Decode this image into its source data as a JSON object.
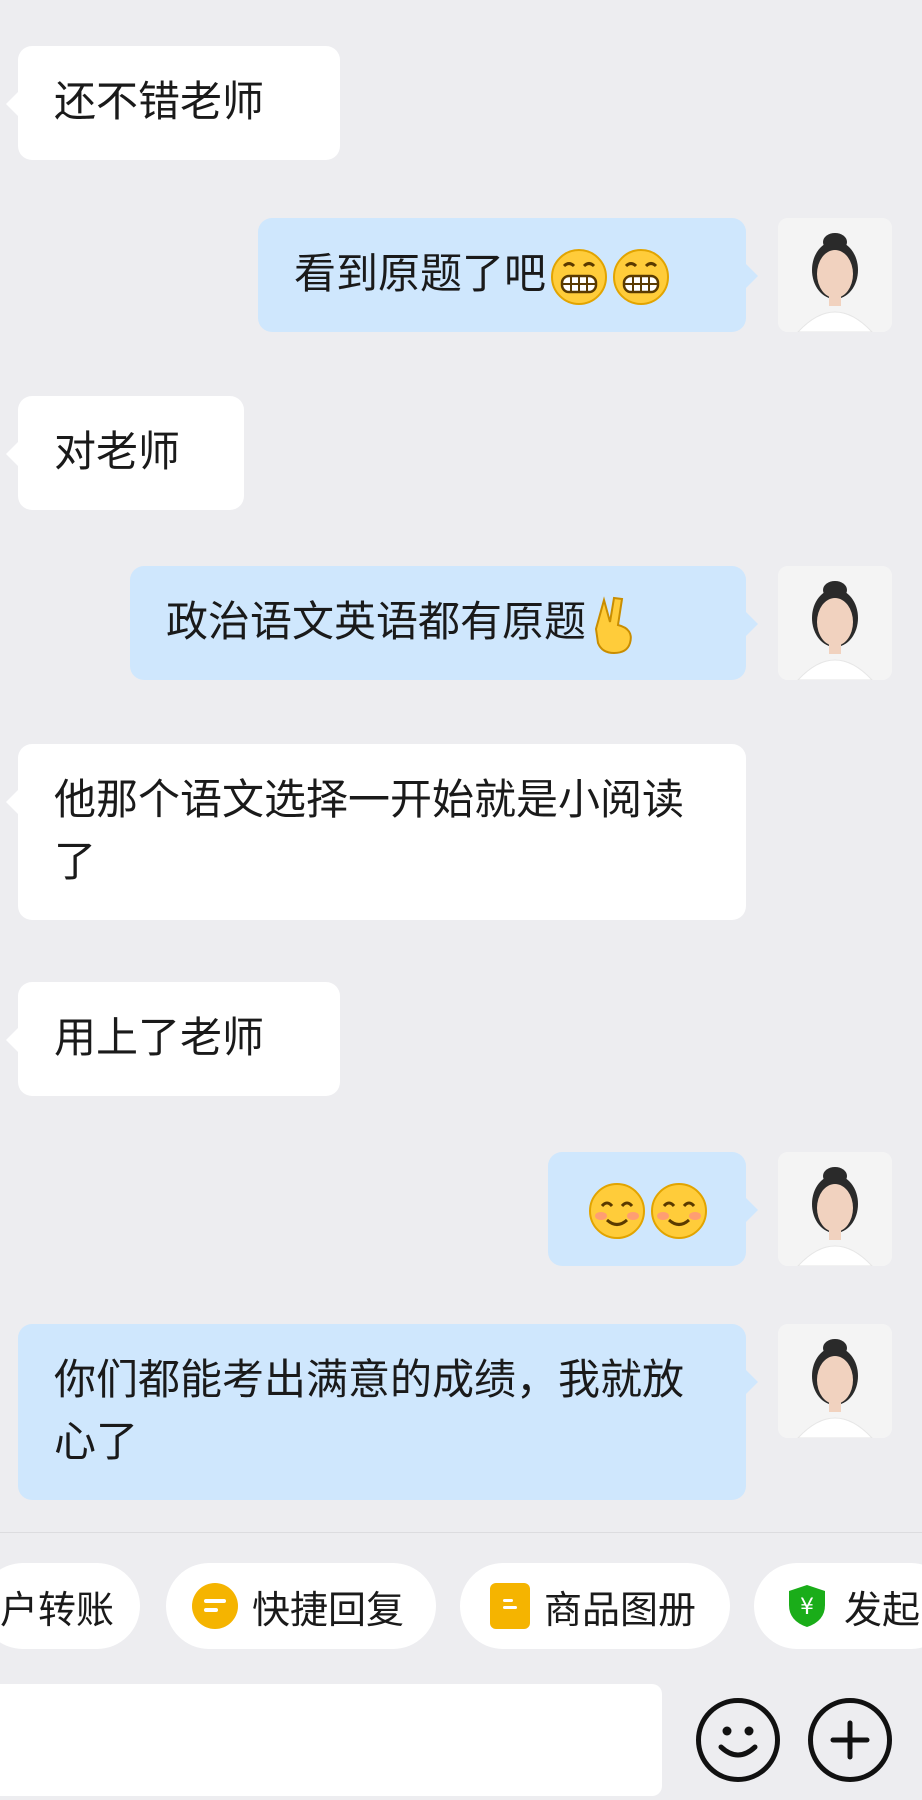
{
  "messages": [
    {
      "side": "in",
      "text": "还不错老师"
    },
    {
      "side": "out",
      "text": "看到原题了吧",
      "emoji": [
        "grin-emoji",
        "grin-emoji"
      ]
    },
    {
      "side": "in",
      "text": "对老师"
    },
    {
      "side": "out",
      "text": "政治语文英语都有原题",
      "emoji": [
        "victory-hand-emoji"
      ]
    },
    {
      "side": "in",
      "text": "他那个语文选择一开始就是小阅读了"
    },
    {
      "side": "in",
      "text": "用上了老师"
    },
    {
      "side": "out",
      "text": "",
      "emoji": [
        "smiling-emoji",
        "smiling-emoji"
      ]
    },
    {
      "side": "out",
      "text": "你们都能考出满意的成绩，我就放心了"
    }
  ],
  "toolbar": {
    "items": [
      {
        "label": "户转账",
        "icon": "transfer-icon"
      },
      {
        "label": "快捷回复",
        "icon": "quick-reply-icon",
        "color": "#f5b400"
      },
      {
        "label": "商品图册",
        "icon": "product-album-icon",
        "color": "#f5b400"
      },
      {
        "label": "发起",
        "icon": "yuan-shield-icon",
        "color": "#1aad19"
      }
    ]
  },
  "input": {
    "placeholder": ""
  },
  "colors": {
    "incoming_bubble": "#ffffff",
    "outgoing_bubble": "#cfe7fd",
    "background": "#ededf0"
  }
}
